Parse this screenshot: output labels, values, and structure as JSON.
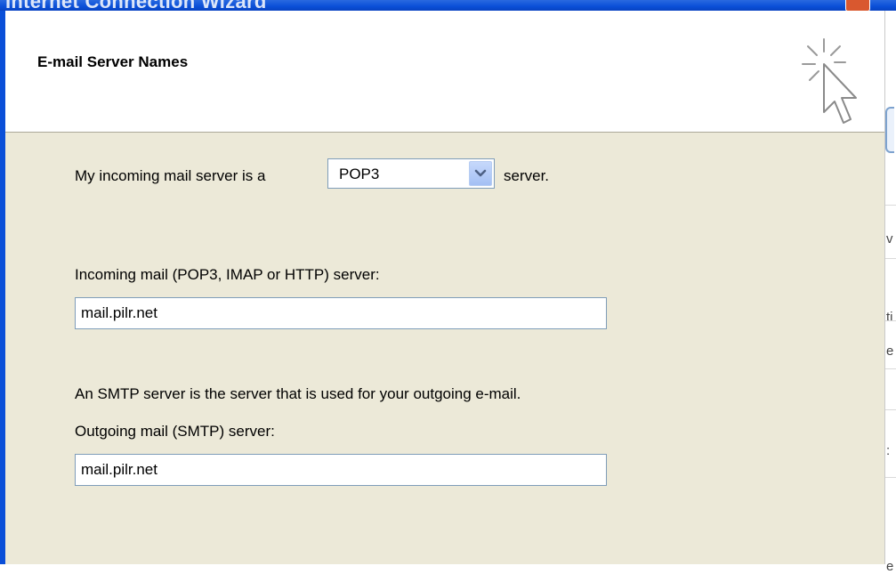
{
  "window": {
    "title": "Internet Connection Wizard"
  },
  "header": {
    "title": "E-mail Server Names",
    "graphic_icon": "sparkle-cursor-icon"
  },
  "incoming_server_type": {
    "prefix_label": "My incoming mail server is a",
    "selected": "POP3",
    "suffix_label": "server."
  },
  "incoming_server": {
    "label": "Incoming mail (POP3, IMAP or HTTP) server:",
    "value": "mail.pilr.net"
  },
  "smtp_info": "An SMTP server is the server that is used for your outgoing e-mail.",
  "outgoing_server": {
    "label": "Outgoing mail (SMTP) server:",
    "value": "mail.pilr.net"
  },
  "background_window": {
    "fragments": [
      "v",
      "ti",
      "e",
      ":",
      "e"
    ]
  },
  "colors": {
    "dialog_bg": "#ece9d8",
    "titlebar": "#0a4fd8",
    "field_border": "#7f9db9"
  }
}
